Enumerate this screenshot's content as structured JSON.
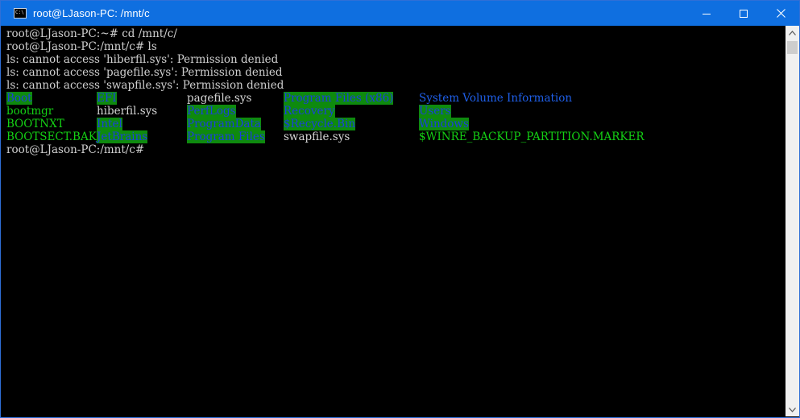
{
  "window": {
    "title": "root@LJason-PC: /mnt/c",
    "icon": "console-icon",
    "accent": "#0f6fe0"
  },
  "controls": {
    "minimize": "minimize-icon",
    "maximize": "maximize-icon",
    "close": "close-icon"
  },
  "terminal": {
    "lines": [
      "root@LJason-PC:~# cd /mnt/c/",
      "root@LJason-PC:/mnt/c# ls",
      "ls: cannot access 'hiberfil.sys': Permission denied",
      "ls: cannot access 'pagefile.sys': Permission denied",
      "ls: cannot access 'swapfile.sys': Permission denied"
    ],
    "listing": [
      [
        "Boot",
        "EFI",
        "pagefile.sys",
        "Program Files (x86)",
        "System Volume Information"
      ],
      [
        "bootmgr",
        "hiberfil.sys",
        "PerfLogs",
        "Recovery",
        "Users"
      ],
      [
        "BOOTNXT",
        "Intel",
        "ProgramData",
        "$Recycle.Bin",
        "Windows"
      ],
      [
        "BOOTSECT.BAK",
        "JetBrains",
        "Program Files",
        "swapfile.sys",
        "$WINRE_BACKUP_PARTITION.MARKER"
      ]
    ],
    "prompt": "root@LJason-PC:/mnt/c#"
  },
  "colors": {
    "background": "#000000",
    "text": "#d0d0d0",
    "green_file": "#14d014",
    "highlight_bg": "#0e8a0e",
    "dir_blue": "#1b3fdc"
  }
}
